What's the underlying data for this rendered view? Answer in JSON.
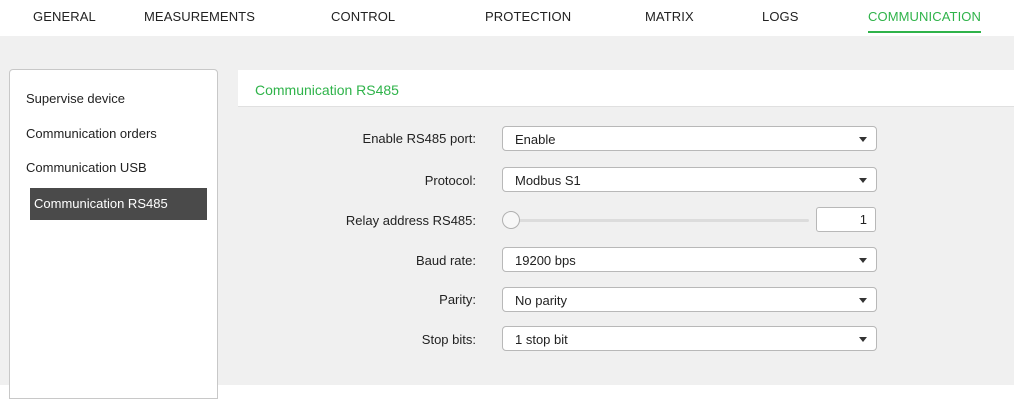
{
  "tabs": [
    {
      "label": "GENERAL"
    },
    {
      "label": "MEASUREMENTS"
    },
    {
      "label": "CONTROL"
    },
    {
      "label": "PROTECTION"
    },
    {
      "label": "MATRIX"
    },
    {
      "label": "LOGS"
    },
    {
      "label": "COMMUNICATION",
      "active": true
    }
  ],
  "sidebar": {
    "items": [
      {
        "label": "Supervise device"
      },
      {
        "label": "Communication orders"
      },
      {
        "label": "Communication USB"
      },
      {
        "label": "Communication RS485",
        "active": true
      }
    ]
  },
  "main": {
    "title": "Communication RS485",
    "fields": {
      "enable_port": {
        "label": "Enable RS485 port:",
        "value": "Enable"
      },
      "protocol": {
        "label": "Protocol:",
        "value": "Modbus S1"
      },
      "relay_address": {
        "label": "Relay address RS485:",
        "value": "1"
      },
      "baud_rate": {
        "label": "Baud rate:",
        "value": "19200 bps"
      },
      "parity": {
        "label": "Parity:",
        "value": "No parity"
      },
      "stop_bits": {
        "label": "Stop bits:",
        "value": "1 stop bit"
      }
    }
  },
  "colors": {
    "accent": "#2fb34a",
    "sidebar_active_bg": "#4a4a4a",
    "band_bg": "#f0f0f0"
  },
  "icons": {
    "dropdown": "chevron-down-icon",
    "slider": "slider-thumb"
  }
}
